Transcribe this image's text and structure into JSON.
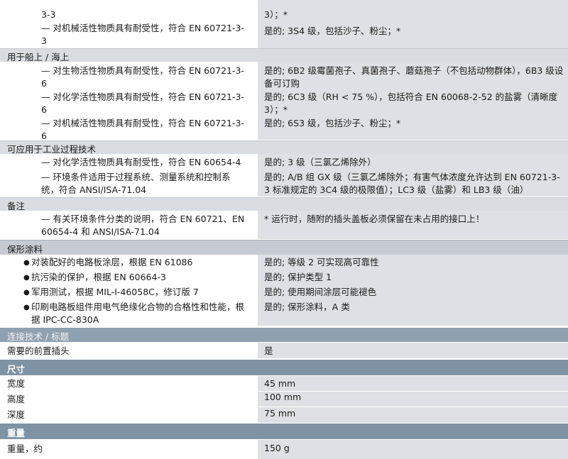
{
  "top": {
    "l0": "3-3",
    "l1": "— 对机械活性物质具有耐受性，符合 EN 60721-3-3",
    "r0": "3）；*",
    "r1": "是的; 3S4 级，包括沙子、粉尘；*"
  },
  "marine": {
    "title": "用于船上 / 海上",
    "rows": [
      {
        "label": "— 对生物活性物质具有耐受性，符合 EN 60721-3-6",
        "value": "是的; 6B2 级霉菌孢子、真菌孢子、蘑菇孢子（不包括动物群体），6B3 级设备可订购"
      },
      {
        "label": "— 对化学活性物质具有耐受性，符合 EN 60721-3-6",
        "value": "是的; 6C3 级（RH < 75 %），包括符合 EN 60068-2-52 的盐雾（清晰度 3）；*"
      },
      {
        "label": "— 对机械活性物质具有耐受性，符合 EN 60721-3-6",
        "value": "是的; 6S3 级，包括沙子、粉尘；*"
      }
    ]
  },
  "industrial": {
    "title": "可应用于工业过程技术",
    "rows": [
      {
        "label": "— 对化学活性物质具有耐受性，符合 EN 60654-4",
        "value": "是的; 3 级（三氯乙烯除外）"
      },
      {
        "label": "— 环境条件适用于过程系统、测量系统和控制系统，符合 ANSI/ISA-71.04",
        "value": "是的; A/B 组 GX 级（三氯乙烯除外；有害气体浓度允许达到 EN 60721-3-3 标准规定的 3C4 级的极限值）；LC3 级（盐雾）和 LB3 级（油）"
      }
    ]
  },
  "notes": {
    "title": "备注",
    "label": "— 有关环境条件分类的说明，符合 EN 60721、EN 60654-4 和 ANSI/ISA-71.04",
    "value": "* 运行时，随附的插头盖板必须保留在未占用的接口上！"
  },
  "coating": {
    "title": "保形涂料",
    "rows": [
      {
        "label": "对装配好的电路板涂层，根据 EN 61086",
        "value": "是的; 等级 2 可实现高可靠性"
      },
      {
        "label": "抗污染的保护，根据 EN 60664-3",
        "value": "是的; 保护类型 1"
      },
      {
        "label": "军用测试，根据 MIL-I-46058C，修订版 7",
        "value": "是的; 使用期间涂层可能褪色"
      },
      {
        "label": "印刷电路板组件用电气绝缘化合物的合格性和性能，根据 IPC-CC-830A",
        "value": "是的; 保形涂料，A 类"
      }
    ]
  },
  "connection": {
    "title": "连接技术 / 标题",
    "label": "需要的前置插头",
    "value": "是"
  },
  "dimensions": {
    "title": "尺寸",
    "rows": [
      {
        "label": "宽度",
        "value": "45 mm"
      },
      {
        "label": "高度",
        "value": "100 mm"
      },
      {
        "label": "深度",
        "value": "75 mm"
      }
    ]
  },
  "weight": {
    "title": "重量",
    "label": "重量，约",
    "value": "150 g"
  }
}
